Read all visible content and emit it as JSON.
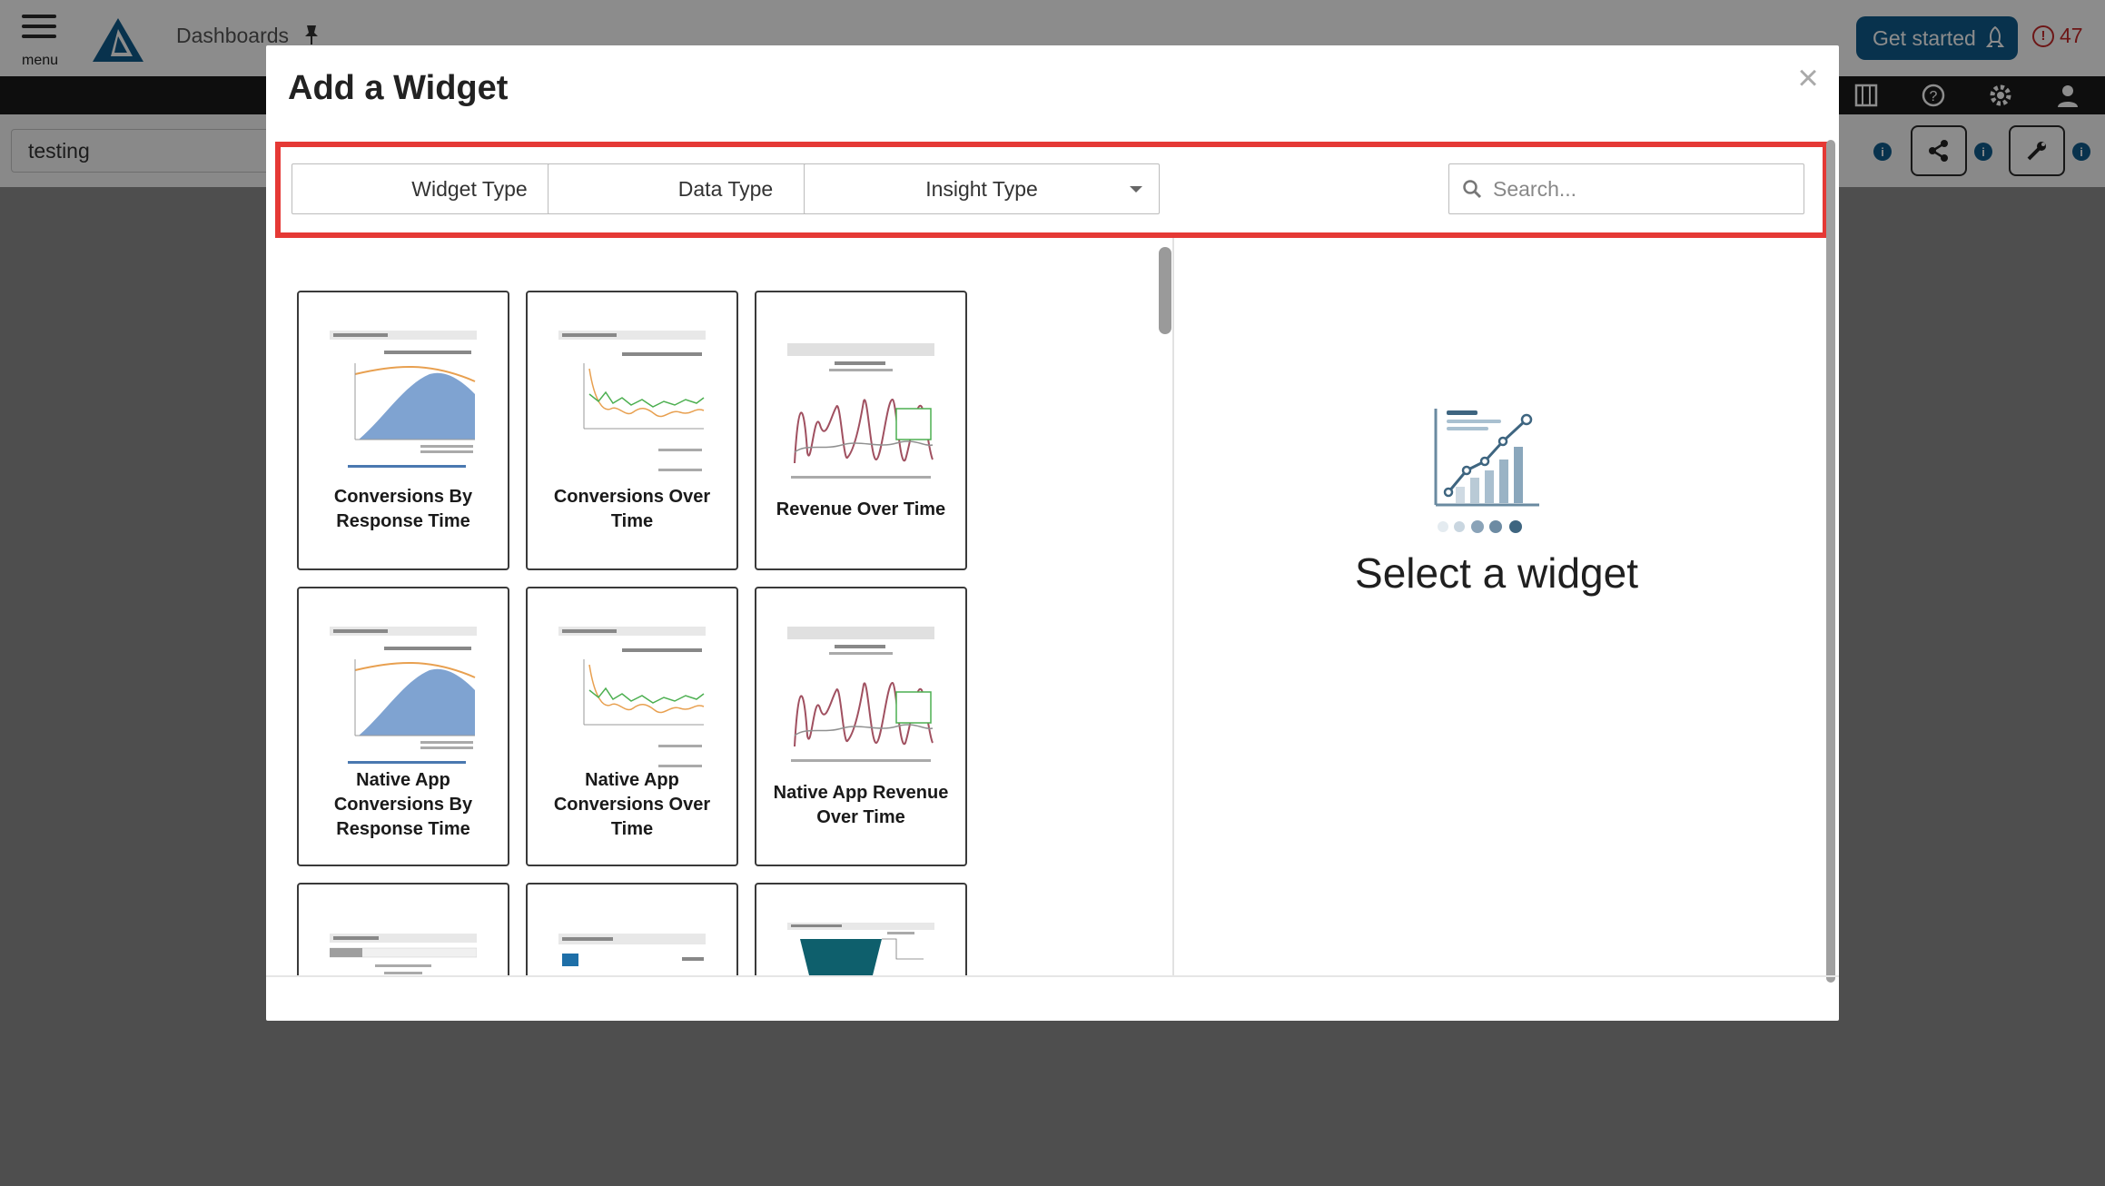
{
  "app": {
    "menu_label": "menu",
    "page_title": "Dashboards",
    "get_started_label": "Get started",
    "alert_count": "47",
    "dashboard_name": "testing"
  },
  "modal": {
    "title": "Add a Widget",
    "close_glyph": "×",
    "filters": {
      "widget_type": "Widget Type",
      "data_type": "Data Type",
      "insight_type": "Insight Type",
      "search_placeholder": "Search..."
    },
    "widgets": [
      {
        "label": "Conversions By Response Time",
        "thumb": "area-chart-thumbnail"
      },
      {
        "label": "Conversions Over Time",
        "thumb": "line-chart-thumbnail"
      },
      {
        "label": "Revenue  Over Time",
        "thumb": "revenue-line-thumbnail"
      },
      {
        "label": "Native App Conversions By Response Time",
        "thumb": "area-chart-thumbnail"
      },
      {
        "label": "Native App Conversions Over Time",
        "thumb": "line-chart-thumbnail"
      },
      {
        "label": "Native App Revenue Over Time",
        "thumb": "revenue-line-thumbnail"
      },
      {
        "label": "",
        "thumb": "revenue-opportunity-thumbnail"
      },
      {
        "label": "",
        "thumb": "campaign-information-thumbnail"
      },
      {
        "label": "",
        "thumb": "funnel-thumbnail"
      }
    ],
    "preview_text": "Select a widget"
  },
  "colors": {
    "accent_brand": "#0f5c8c",
    "highlight_border": "#e53935",
    "alert": "#c62828"
  }
}
